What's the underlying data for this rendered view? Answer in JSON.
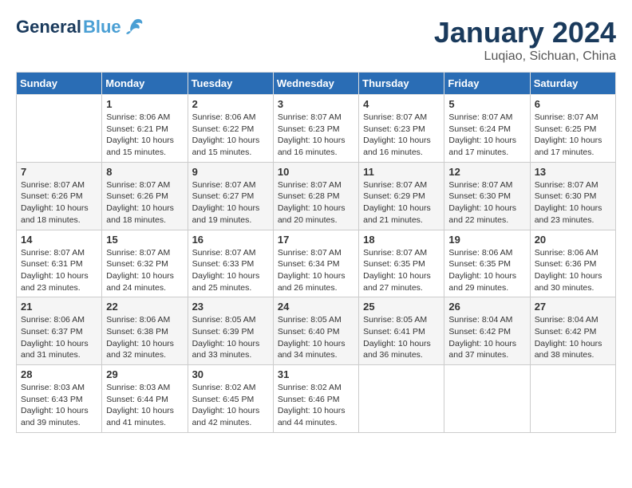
{
  "header": {
    "logo_general": "General",
    "logo_blue": "Blue",
    "title": "January 2024",
    "location": "Luqiao, Sichuan, China"
  },
  "days_of_week": [
    "Sunday",
    "Monday",
    "Tuesday",
    "Wednesday",
    "Thursday",
    "Friday",
    "Saturday"
  ],
  "weeks": [
    [
      {
        "day": "",
        "info": ""
      },
      {
        "day": "1",
        "info": "Sunrise: 8:06 AM\nSunset: 6:21 PM\nDaylight: 10 hours\nand 15 minutes."
      },
      {
        "day": "2",
        "info": "Sunrise: 8:06 AM\nSunset: 6:22 PM\nDaylight: 10 hours\nand 15 minutes."
      },
      {
        "day": "3",
        "info": "Sunrise: 8:07 AM\nSunset: 6:23 PM\nDaylight: 10 hours\nand 16 minutes."
      },
      {
        "day": "4",
        "info": "Sunrise: 8:07 AM\nSunset: 6:23 PM\nDaylight: 10 hours\nand 16 minutes."
      },
      {
        "day": "5",
        "info": "Sunrise: 8:07 AM\nSunset: 6:24 PM\nDaylight: 10 hours\nand 17 minutes."
      },
      {
        "day": "6",
        "info": "Sunrise: 8:07 AM\nSunset: 6:25 PM\nDaylight: 10 hours\nand 17 minutes."
      }
    ],
    [
      {
        "day": "7",
        "info": "Sunrise: 8:07 AM\nSunset: 6:26 PM\nDaylight: 10 hours\nand 18 minutes."
      },
      {
        "day": "8",
        "info": "Sunrise: 8:07 AM\nSunset: 6:26 PM\nDaylight: 10 hours\nand 18 minutes."
      },
      {
        "day": "9",
        "info": "Sunrise: 8:07 AM\nSunset: 6:27 PM\nDaylight: 10 hours\nand 19 minutes."
      },
      {
        "day": "10",
        "info": "Sunrise: 8:07 AM\nSunset: 6:28 PM\nDaylight: 10 hours\nand 20 minutes."
      },
      {
        "day": "11",
        "info": "Sunrise: 8:07 AM\nSunset: 6:29 PM\nDaylight: 10 hours\nand 21 minutes."
      },
      {
        "day": "12",
        "info": "Sunrise: 8:07 AM\nSunset: 6:30 PM\nDaylight: 10 hours\nand 22 minutes."
      },
      {
        "day": "13",
        "info": "Sunrise: 8:07 AM\nSunset: 6:30 PM\nDaylight: 10 hours\nand 23 minutes."
      }
    ],
    [
      {
        "day": "14",
        "info": "Sunrise: 8:07 AM\nSunset: 6:31 PM\nDaylight: 10 hours\nand 23 minutes."
      },
      {
        "day": "15",
        "info": "Sunrise: 8:07 AM\nSunset: 6:32 PM\nDaylight: 10 hours\nand 24 minutes."
      },
      {
        "day": "16",
        "info": "Sunrise: 8:07 AM\nSunset: 6:33 PM\nDaylight: 10 hours\nand 25 minutes."
      },
      {
        "day": "17",
        "info": "Sunrise: 8:07 AM\nSunset: 6:34 PM\nDaylight: 10 hours\nand 26 minutes."
      },
      {
        "day": "18",
        "info": "Sunrise: 8:07 AM\nSunset: 6:35 PM\nDaylight: 10 hours\nand 27 minutes."
      },
      {
        "day": "19",
        "info": "Sunrise: 8:06 AM\nSunset: 6:35 PM\nDaylight: 10 hours\nand 29 minutes."
      },
      {
        "day": "20",
        "info": "Sunrise: 8:06 AM\nSunset: 6:36 PM\nDaylight: 10 hours\nand 30 minutes."
      }
    ],
    [
      {
        "day": "21",
        "info": "Sunrise: 8:06 AM\nSunset: 6:37 PM\nDaylight: 10 hours\nand 31 minutes."
      },
      {
        "day": "22",
        "info": "Sunrise: 8:06 AM\nSunset: 6:38 PM\nDaylight: 10 hours\nand 32 minutes."
      },
      {
        "day": "23",
        "info": "Sunrise: 8:05 AM\nSunset: 6:39 PM\nDaylight: 10 hours\nand 33 minutes."
      },
      {
        "day": "24",
        "info": "Sunrise: 8:05 AM\nSunset: 6:40 PM\nDaylight: 10 hours\nand 34 minutes."
      },
      {
        "day": "25",
        "info": "Sunrise: 8:05 AM\nSunset: 6:41 PM\nDaylight: 10 hours\nand 36 minutes."
      },
      {
        "day": "26",
        "info": "Sunrise: 8:04 AM\nSunset: 6:42 PM\nDaylight: 10 hours\nand 37 minutes."
      },
      {
        "day": "27",
        "info": "Sunrise: 8:04 AM\nSunset: 6:42 PM\nDaylight: 10 hours\nand 38 minutes."
      }
    ],
    [
      {
        "day": "28",
        "info": "Sunrise: 8:03 AM\nSunset: 6:43 PM\nDaylight: 10 hours\nand 39 minutes."
      },
      {
        "day": "29",
        "info": "Sunrise: 8:03 AM\nSunset: 6:44 PM\nDaylight: 10 hours\nand 41 minutes."
      },
      {
        "day": "30",
        "info": "Sunrise: 8:02 AM\nSunset: 6:45 PM\nDaylight: 10 hours\nand 42 minutes."
      },
      {
        "day": "31",
        "info": "Sunrise: 8:02 AM\nSunset: 6:46 PM\nDaylight: 10 hours\nand 44 minutes."
      },
      {
        "day": "",
        "info": ""
      },
      {
        "day": "",
        "info": ""
      },
      {
        "day": "",
        "info": ""
      }
    ]
  ]
}
